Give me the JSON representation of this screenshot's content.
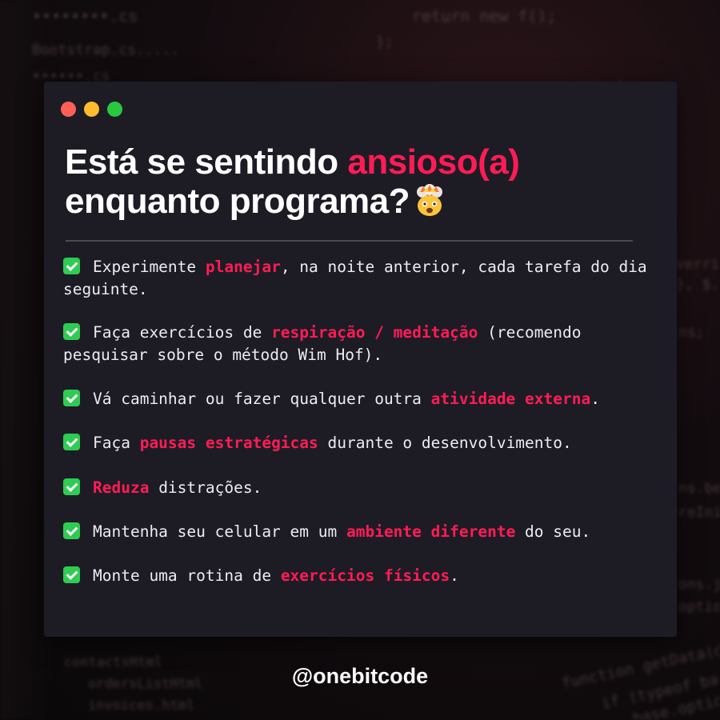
{
  "window": {
    "controls": [
      "close",
      "minimize",
      "maximize"
    ],
    "colors": {
      "close": "#ff5f57",
      "minimize": "#febc2e",
      "maximize": "#28c840"
    }
  },
  "title": {
    "line1_part1": "Está se sentindo ",
    "line1_accent": "ansioso(a)",
    "line2": "enquanto programa?",
    "emoji": "exploding-head-emoji"
  },
  "colors": {
    "accent": "#ff1c55",
    "card_bg": "#1d1c25",
    "check": "#2ecc52",
    "text": "#ececf0"
  },
  "tips": [
    {
      "before": "Experimente ",
      "highlight": "planejar",
      "after": ", na noite anterior, cada tarefa do dia seguinte."
    },
    {
      "before": "Faça exercícios de ",
      "highlight": "respiração / meditação",
      "after": " (recomendo pesquisar sobre o método Wim Hof)."
    },
    {
      "before": "Vá caminhar ou fazer qualquer outra ",
      "highlight": "atividade externa",
      "after": "."
    },
    {
      "before": "Faça ",
      "highlight": "pausas estratégicas",
      "after": " durante o desenvolvimento."
    },
    {
      "before": "",
      "highlight": "Reduza",
      "after": " distrações."
    },
    {
      "before": "Mantenha seu celular em um ",
      "highlight": "ambiente diferente",
      "after": " do seu."
    },
    {
      "before": "Monte uma rotina de ",
      "highlight": "exercícios físicos",
      "after": "."
    }
  ],
  "footer": {
    "handle": "@onebitcode"
  }
}
